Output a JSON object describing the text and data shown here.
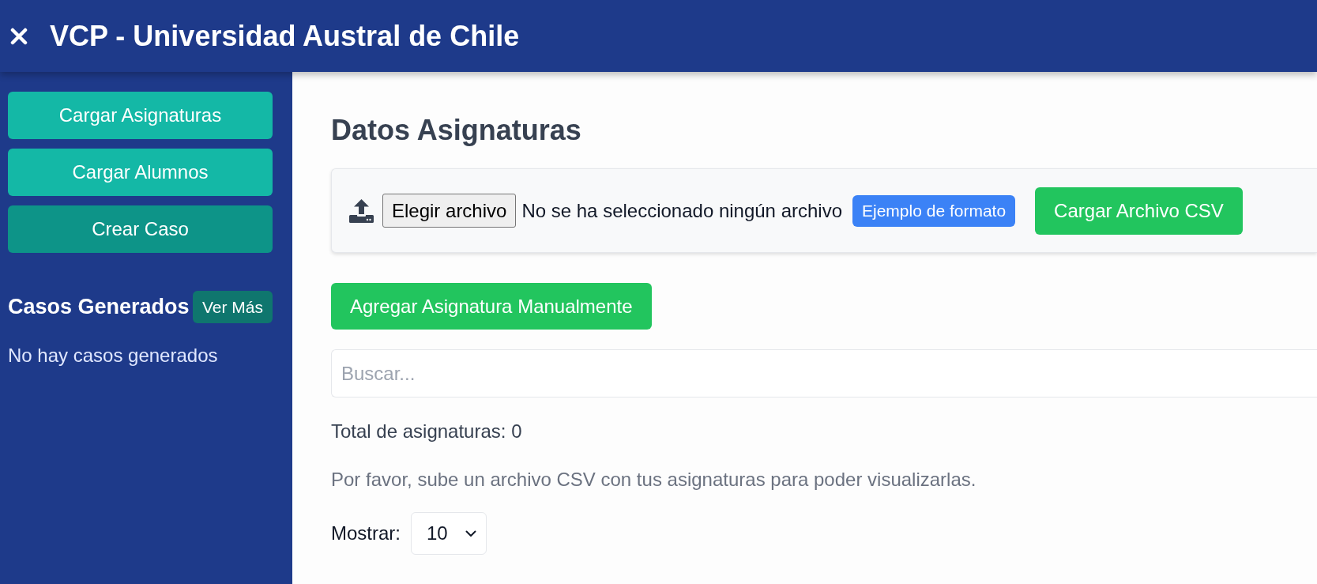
{
  "header": {
    "title": "VCP - Universidad Austral de Chile"
  },
  "sidebar": {
    "buttons": [
      {
        "label": "Cargar Asignaturas",
        "selected": false
      },
      {
        "label": "Cargar Alumnos",
        "selected": false
      },
      {
        "label": "Crear Caso",
        "selected": true
      }
    ],
    "cases": {
      "title": "Casos Generados",
      "more_button": "Ver Más",
      "empty_text": "No hay casos generados"
    }
  },
  "main": {
    "title": "Datos Asignaturas",
    "upload": {
      "file_button": "Elegir archivo",
      "file_status": "No se ha seleccionado ningún archivo",
      "format_button": "Ejemplo de formato",
      "submit_button": "Cargar Archivo CSV"
    },
    "add_button": "Agregar Asignatura Manualmente",
    "search": {
      "placeholder": "Buscar..."
    },
    "total": "Total de asignaturas: 0",
    "hint": "Por favor, sube un archivo CSV con tus asignaturas para poder visualizarlas.",
    "page_size": {
      "label": "Mostrar:",
      "value": "10"
    }
  }
}
